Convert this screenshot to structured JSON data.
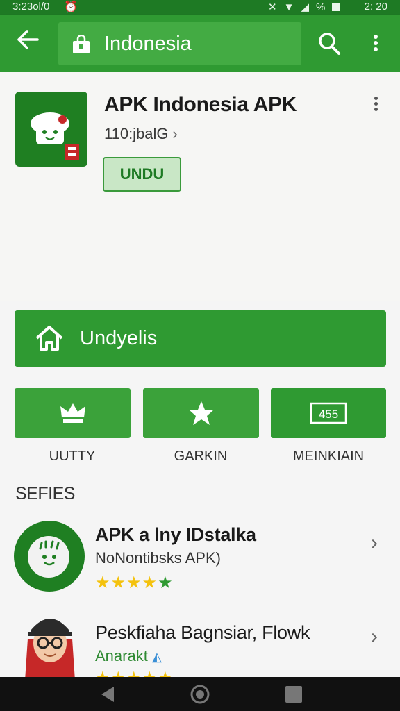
{
  "status_bar": {
    "time_left": "3:23ol/0",
    "time_right": "2: 20",
    "battery_text": "%"
  },
  "app_bar": {
    "query": "Indonesia",
    "back_icon": "arrow-left-icon",
    "search_icon": "search-icon",
    "more_icon": "more-vert-icon"
  },
  "app": {
    "title": "APK Indonesia APK",
    "developer": "110:jbalG",
    "developer_chevron": "›",
    "install_label": "UNDU"
  },
  "wide_button": {
    "label": "Undyelis",
    "icon": "home-icon"
  },
  "tiles": [
    {
      "label": "UUTTY",
      "icon": "crown-icon"
    },
    {
      "label": "GARKIN",
      "icon": "star-icon"
    },
    {
      "label": "MEINKIAIN",
      "icon": "badge-icon",
      "badge_text": "455"
    }
  ],
  "section": {
    "title": "SEFIES"
  },
  "list": [
    {
      "title": "APK a lny IDstalka",
      "subtitle": "NoNontibsks  APK)",
      "chevron": "›",
      "rating": 5
    },
    {
      "title": "Peskfiaha Bagnsiar, Flowk",
      "subtitle": "Anarakt",
      "chevron": "›",
      "rating": 5
    }
  ],
  "colors": {
    "primary": "#2f9a32",
    "primary_dark": "#1e7a24",
    "accent": "#43ab43",
    "star": "#f4c20d"
  }
}
